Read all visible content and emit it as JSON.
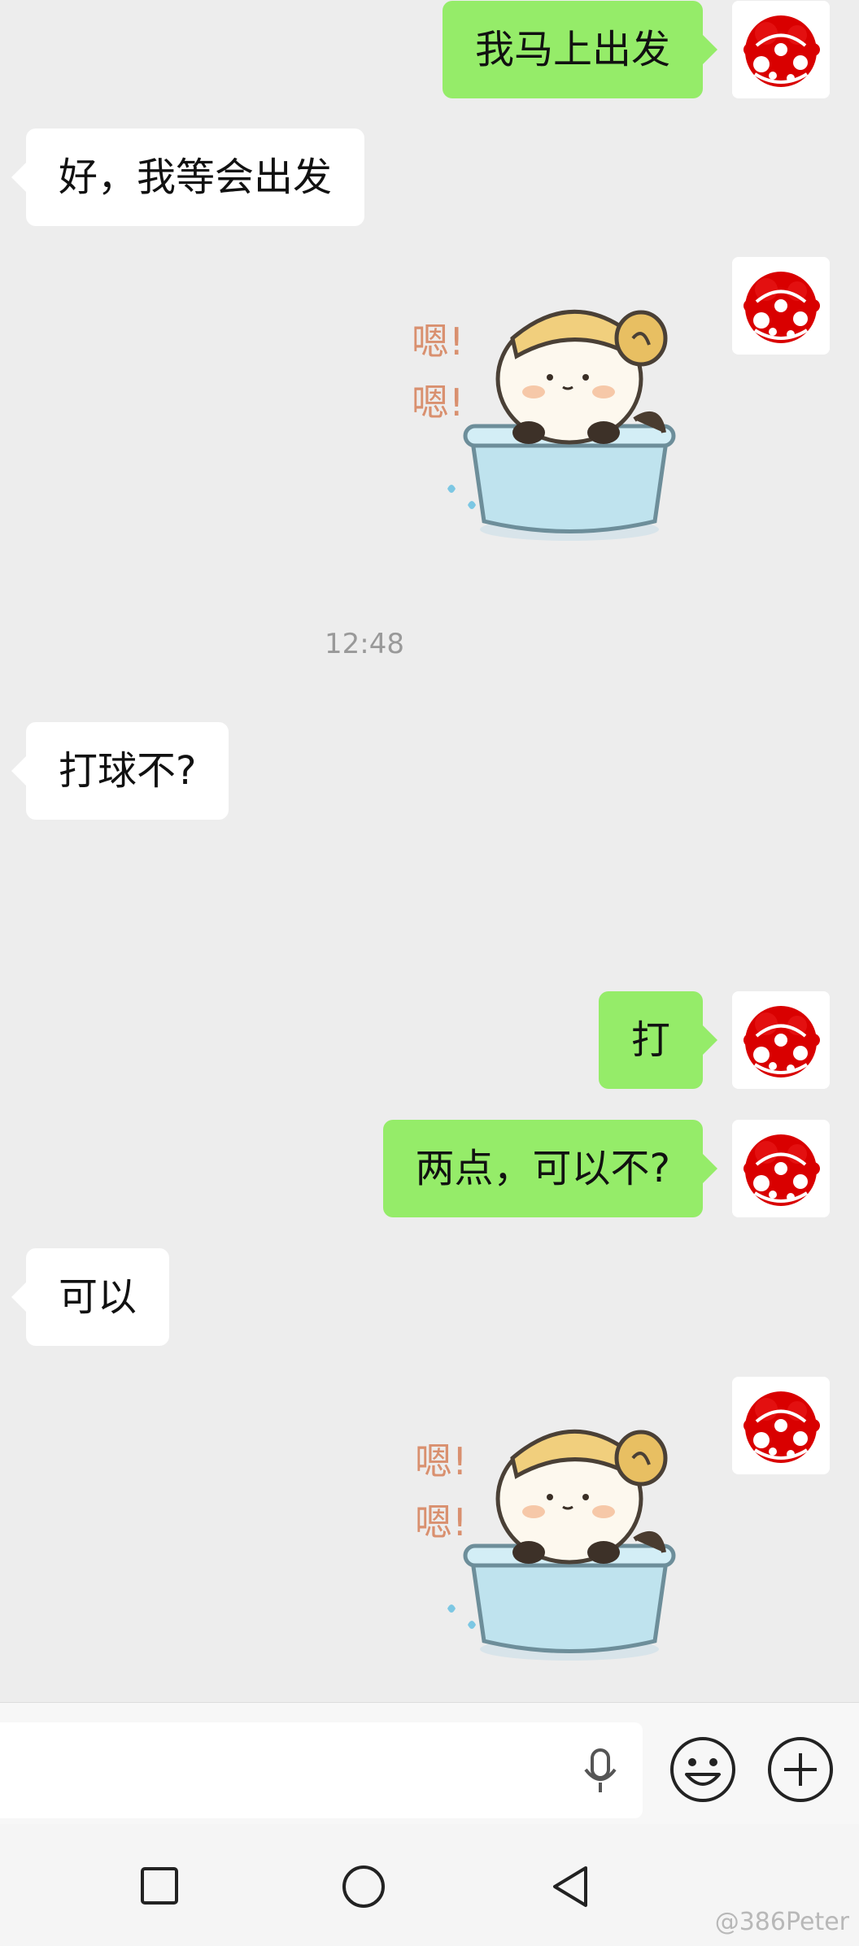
{
  "messages": {
    "m1": "我马上出发",
    "m2": "好，我等会出发",
    "m3": "打球不?",
    "m4": "打",
    "m5": "两点，可以不?",
    "m6": "可以"
  },
  "timestamp": "12:48",
  "sticker": {
    "caption_top": "嗯!",
    "caption_bottom": "嗯!"
  },
  "watermark": "@386Peter",
  "colors": {
    "bubble_self": "#95ec69",
    "bubble_other": "#ffffff",
    "background": "#ededed",
    "avatar_red": "#e00000"
  },
  "icons": {
    "voice": "microphone-icon",
    "emoji": "smiley-icon",
    "more": "plus-circle-icon",
    "nav_recent": "square-icon",
    "nav_home": "circle-icon",
    "nav_back": "triangle-back-icon"
  }
}
